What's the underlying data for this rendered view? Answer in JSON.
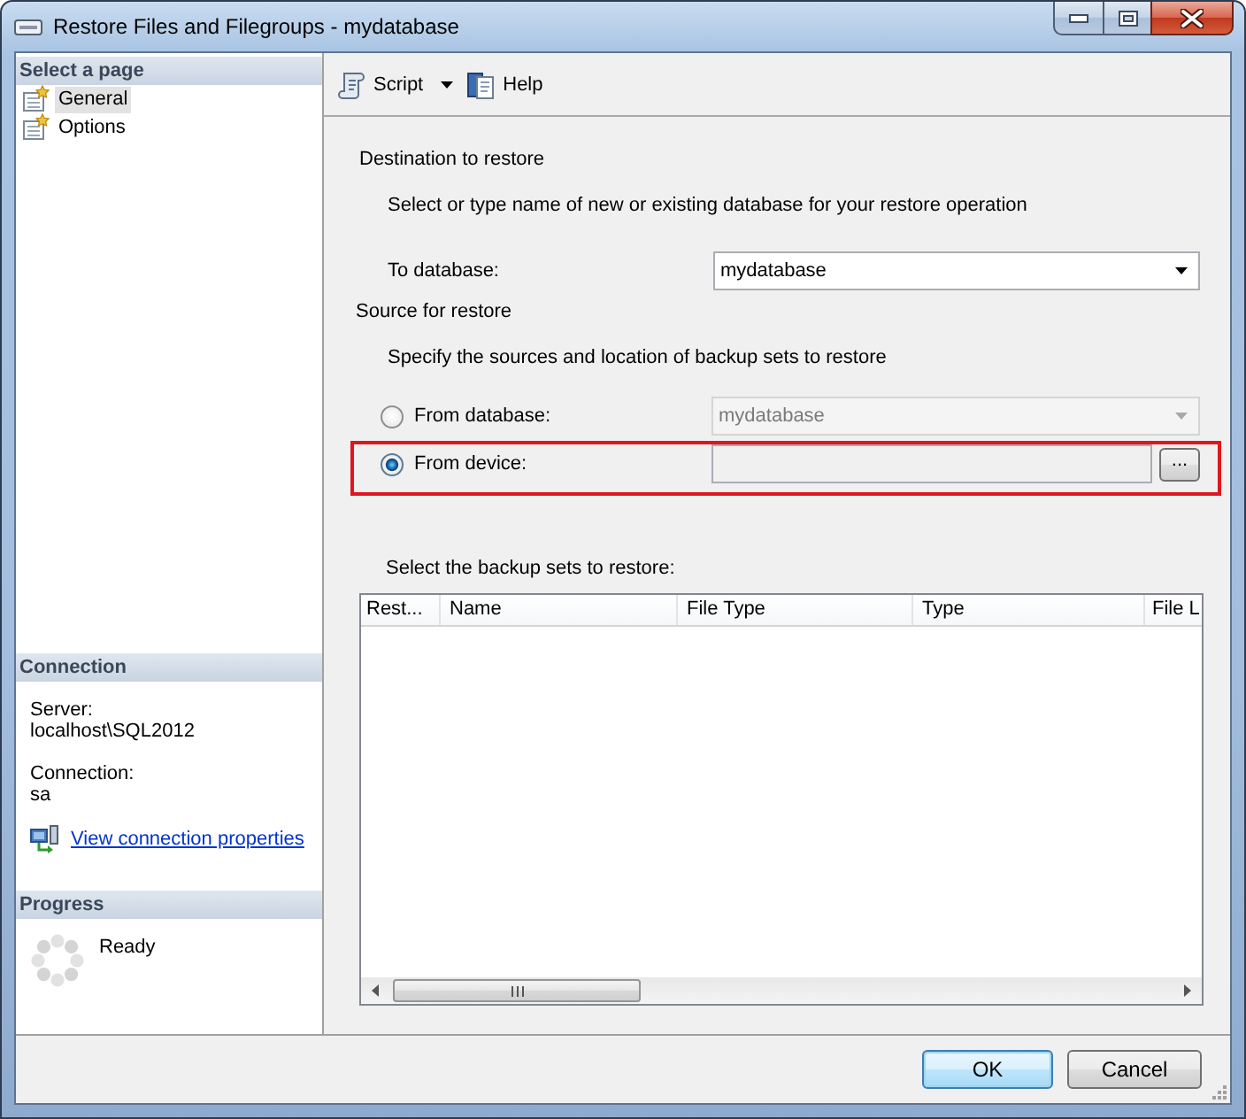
{
  "window": {
    "title": "Restore Files and Filegroups - mydatabase"
  },
  "sidebar": {
    "heading": "Select a page",
    "pages": [
      {
        "label": "General",
        "selected": true
      },
      {
        "label": "Options",
        "selected": false
      }
    ]
  },
  "connection": {
    "heading": "Connection",
    "fields": [
      {
        "label": "Server:",
        "value": "localhost\\SQL2012"
      },
      {
        "label": "Connection:",
        "value": "sa"
      }
    ],
    "link": "View connection properties"
  },
  "progress": {
    "heading": "Progress",
    "status": "Ready"
  },
  "toolbar": [
    {
      "label": "Script",
      "kind": "script",
      "dropdown": true
    },
    {
      "label": "Help",
      "kind": "help",
      "dropdown": false
    }
  ],
  "destination": {
    "heading": "Destination to restore",
    "description": "Select or type name of new or existing database for your restore operation",
    "label": "To database:",
    "value": "mydatabase"
  },
  "source": {
    "heading": "Source for restore",
    "description": "Specify the sources and location of backup sets to restore",
    "options": [
      {
        "label": "From database:",
        "kind": "database",
        "selected": false,
        "disabled": true,
        "highlighted": false,
        "value": "mydatabase"
      },
      {
        "label": "From device:",
        "kind": "device",
        "selected": true,
        "disabled": false,
        "highlighted": true,
        "button": "..."
      }
    ]
  },
  "backup_sets": {
    "label": "Select the backup sets to restore:",
    "columns": [
      "Rest...",
      "Name",
      "File Type",
      "Type",
      "File L"
    ]
  },
  "buttons": [
    {
      "label": "OK",
      "default": true
    },
    {
      "label": "Cancel",
      "default": false
    }
  ]
}
